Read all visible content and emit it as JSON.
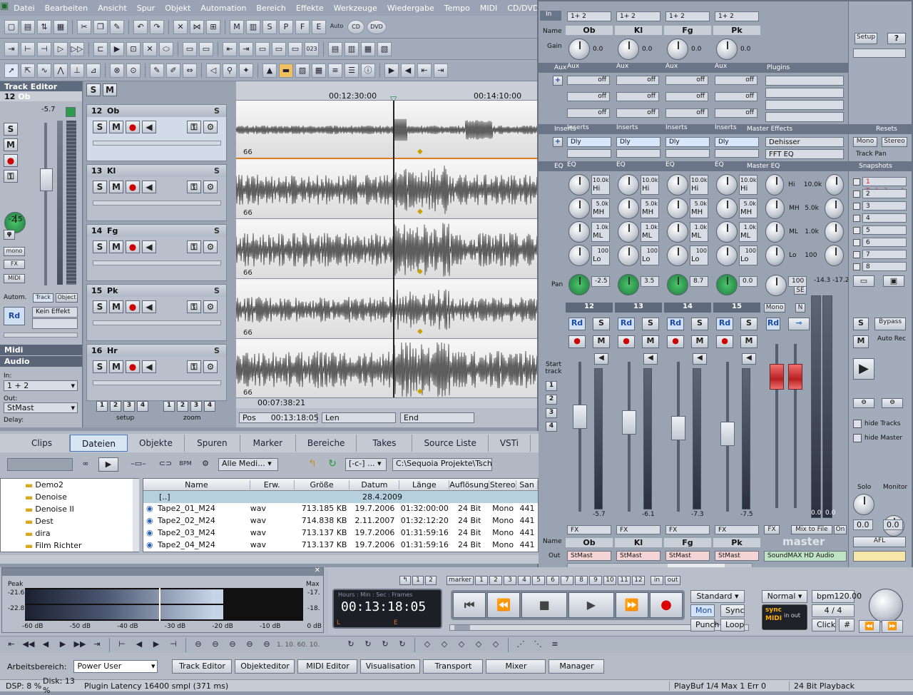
{
  "menu": [
    "Datei",
    "Bearbeiten",
    "Ansicht",
    "Spur",
    "Objekt",
    "Automation",
    "Bereich",
    "Effekte",
    "Werkzeuge",
    "Wiedergabe",
    "Tempo",
    "MIDI",
    "CD/DVD",
    "Optionen",
    "Fen"
  ],
  "toolbar": {
    "auto_label": "Auto",
    "cd_label": "CD",
    "dvd_label": "DVD",
    "counter_label": "023"
  },
  "track_editor": {
    "title": "Track Editor",
    "track_num": "12",
    "track_name": "Ob",
    "level": "-5.7",
    "pan_value": "-2.5",
    "mono": "mono",
    "fx": "FX",
    "midi": "MIDI",
    "autom": "Autom.",
    "track_tab": "Track",
    "object_tab": "Object",
    "rd": "Rd",
    "effect": "Kein Effekt",
    "midi_section": "Midi",
    "audio_section": "Audio",
    "in_label": "In:",
    "in_value": "1 + 2",
    "out_label": "Out:",
    "out_value": "StMast",
    "delay_label": "Delay:"
  },
  "tracks_header": {
    "s": "S",
    "m": "M"
  },
  "tracks": [
    {
      "num": "12",
      "name": "Ob",
      "level": "66"
    },
    {
      "num": "13",
      "name": "Kl",
      "level": "66"
    },
    {
      "num": "14",
      "name": "Fg",
      "level": "66"
    },
    {
      "num": "15",
      "name": "Pk",
      "level": "66"
    },
    {
      "num": "16",
      "name": "Hr",
      "level": "66"
    }
  ],
  "timeline": {
    "t1": "00:12:30:00",
    "t2": "00:14:10:00",
    "cursor_time": "00:07:38:21"
  },
  "setup_zoom": {
    "setup": "setup",
    "zoom": "zoom",
    "nums": [
      "1",
      "2",
      "3",
      "4"
    ]
  },
  "posbar": {
    "pos_label": "Pos",
    "pos_value": "00:13:18:05",
    "len_label": "Len",
    "end_label": "End"
  },
  "browser": {
    "tabs": [
      "Clips",
      "Dateien",
      "Objekte",
      "Spuren",
      "Marker",
      "Bereiche",
      "Takes",
      "Source Liste",
      "VSTi"
    ],
    "active_tab": "Dateien",
    "filter": "Alle Medi...",
    "drive": "[-c-] ...",
    "path": "C:\\Sequoia Projekte\\Tsch",
    "bpm": "BPM",
    "folders": [
      "Demo2",
      "Denoise",
      "Denoise II",
      "Dest",
      "dira",
      "Film Richter"
    ],
    "columns": [
      "Name",
      "Erw.",
      "Größe",
      "Datum",
      "Länge",
      "Auflösung",
      "Stereo",
      "San"
    ],
    "parent": {
      "name": "[..]",
      "date": "28.4.2009"
    },
    "files": [
      {
        "name": "Tape2_01_M24",
        "ext": "wav",
        "size": "713.185 KB",
        "date": "19.7.2006",
        "len": "01:32:00:00",
        "res": "24 Bit",
        "stereo": "Mono",
        "sr": "441"
      },
      {
        "name": "Tape2_02_M24",
        "ext": "wav",
        "size": "714.838 KB",
        "date": "2.11.2007",
        "len": "01:32:12:20",
        "res": "24 Bit",
        "stereo": "Mono",
        "sr": "441"
      },
      {
        "name": "Tape2_03_M24",
        "ext": "wav",
        "size": "713.137 KB",
        "date": "19.7.2006",
        "len": "01:31:59:16",
        "res": "24 Bit",
        "stereo": "Mono",
        "sr": "441"
      },
      {
        "name": "Tape2_04_M24",
        "ext": "wav",
        "size": "713.137 KB",
        "date": "19.7.2006",
        "len": "01:31:59:16",
        "res": "24 Bit",
        "stereo": "Mono",
        "sr": "441"
      }
    ]
  },
  "mixer": {
    "row_labels": {
      "in": "In",
      "name": "Name",
      "gain": "Gain",
      "aux": "Aux",
      "inserts": "Inserts",
      "eq": "EQ",
      "pan": "Pan",
      "start_track": "Start track",
      "name2": "Name",
      "out": "Out"
    },
    "channels": [
      {
        "in": "1+ 2",
        "name": "Ob",
        "gain": "0.0",
        "insert": "Dly",
        "hi": "10.0k",
        "mh": "5.0k",
        "ml": "1.0k",
        "lo": "100",
        "pan": "-2.5",
        "num": "12",
        "meter": "-5.7",
        "fx": "FX",
        "out": "StMast"
      },
      {
        "in": "1+ 2",
        "name": "Kl",
        "gain": "0.0",
        "insert": "Dly",
        "hi": "10.0k",
        "mh": "5.0k",
        "ml": "1.0k",
        "lo": "100",
        "pan": "3.5",
        "num": "13",
        "meter": "-6.1",
        "fx": "FX",
        "out": "StMast"
      },
      {
        "in": "1+ 2",
        "name": "Fg",
        "gain": "0.0",
        "insert": "Dly",
        "hi": "10.0k",
        "mh": "5.0k",
        "ml": "1.0k",
        "lo": "100",
        "pan": "8.7",
        "num": "14",
        "meter": "-7.3",
        "fx": "FX",
        "out": "StMast"
      },
      {
        "in": "1+ 2",
        "name": "Pk",
        "gain": "0.0",
        "insert": "Dly",
        "hi": "10.0k",
        "mh": "5.0k",
        "ml": "1.0k",
        "lo": "100",
        "pan": "0.0",
        "num": "15",
        "meter": "-7.5",
        "fx": "FX",
        "out": "StMast"
      }
    ],
    "eq_labels": [
      "Hi",
      "MH",
      "ML",
      "Lo"
    ],
    "off": "off",
    "plugins": "Plugins",
    "master_effects": "Master Effects",
    "master_fx": [
      "Dehisser",
      "FFT EQ"
    ],
    "master_eq": "Master EQ",
    "master_eq_vals": [
      {
        "l": "Hi",
        "v": "10.0k"
      },
      {
        "l": "MH",
        "v": "5.0k"
      },
      {
        "l": "ML",
        "v": "1.0k"
      },
      {
        "l": "Lo",
        "v": "100"
      }
    ],
    "master_pan": "100",
    "se": "SE",
    "master_meter_vals": "-14.3 -17.2",
    "mono_btn": "Mono",
    "n_btn": "N",
    "master_label": "master",
    "mix_to_file": "Mix to File",
    "on": "On",
    "master_out": "SoundMAX HD Audio",
    "master_meter_bottom": [
      "0.0",
      "0.0"
    ],
    "setup": "Setup",
    "help": "?",
    "resets": "Resets",
    "reset_mono": "Mono",
    "reset_stereo": "Stereo",
    "track_pan": "Track Pan",
    "snapshots": "Snapshots",
    "snap_list": [
      "1 Tschaikowsk",
      "2",
      "3",
      "4",
      "5",
      "6",
      "7",
      "8"
    ],
    "bypass": "Bypass",
    "auto_rec": "Auto Rec",
    "hide_tracks": "hide Tracks",
    "hide_master": "hide Master",
    "solo": "Solo",
    "monitor": "Monitor",
    "solo_val": "0.0",
    "monitor_val": "0.0",
    "afl": "AFL",
    "rd": "Rd",
    "s": "S",
    "m": "M",
    "start_nums": [
      "1",
      "2",
      "3",
      "4"
    ]
  },
  "peak": {
    "peak_label": "Peak",
    "max_label": "Max",
    "left_vals": [
      "-21.6",
      "-22.8"
    ],
    "right_vals": [
      "-17.",
      "-18."
    ],
    "scale": [
      "-60 dB",
      "-50 dB",
      "-40 dB",
      "-30 dB",
      "-20 dB",
      "-10 dB",
      "0 dB"
    ]
  },
  "transport": {
    "time_header": "Hours : Min : Sec : Frames",
    "time": "00:13:18:05",
    "l": "L",
    "e": "E"
  },
  "markers": {
    "marker": "marker",
    "nums": [
      "1",
      "2",
      "3",
      "4",
      "5",
      "6",
      "7",
      "8",
      "9",
      "10",
      "11",
      "12"
    ],
    "in": "in",
    "out": "out",
    "top_nums": [
      "1",
      "2"
    ]
  },
  "modes": {
    "standard": "Standard",
    "mon": "Mon",
    "sync": "Sync",
    "punch": "Punch",
    "loop": "Loop",
    "normal": "Normal",
    "bpm": "bpm120.00",
    "sig": "4 / 4",
    "click": "Click",
    "sync_in_out": "in  out",
    "sync_lbl": "sync",
    "midi_lbl": "MIDI"
  },
  "scrub_nums": "1. 10. 60. 10.",
  "workspace": {
    "label": "Arbeitsbereich:",
    "value": "Power User",
    "buttons": [
      "Track Editor",
      "Objekteditor",
      "MIDI Editor",
      "Visualisation",
      "Transport",
      "Mixer",
      "Manager"
    ]
  },
  "status": {
    "dsp": "DSP: 8 %",
    "disk": "Disk: 13 %",
    "latency": "Plugin Latency 16400 smpl (371 ms)",
    "playbuf": "PlayBuf 1/4  Max 1  Err 0",
    "playback": "24 Bit Playback"
  }
}
